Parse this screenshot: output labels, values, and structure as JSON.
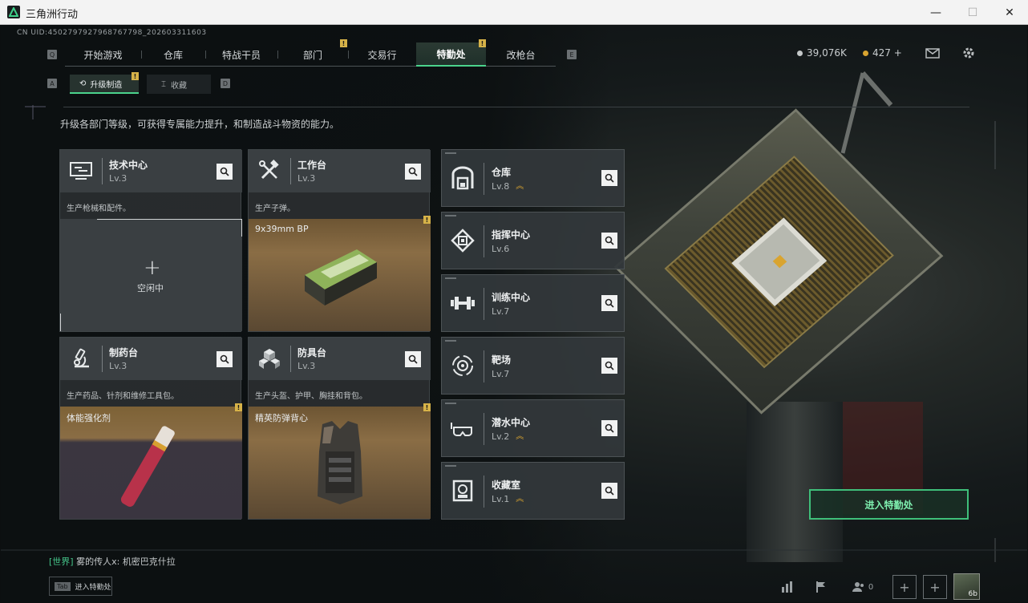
{
  "window": {
    "title": "三角洲行动",
    "minimize": "—",
    "maximize": "☐",
    "close": "✕"
  },
  "uid": "CN UID:4502797927968767798_202603311603",
  "nav": {
    "key_left": "Q",
    "key_right": "E",
    "tabs": [
      {
        "label": "开始游戏"
      },
      {
        "label": "仓库"
      },
      {
        "label": "特战干员"
      },
      {
        "label": "部门"
      },
      {
        "label": "交易行"
      },
      {
        "label": "特勤处"
      },
      {
        "label": "改枪台"
      }
    ],
    "active": "特勤处"
  },
  "subnav": {
    "key_left": "A",
    "key_right": "D",
    "tabs": [
      {
        "label": "升级制造"
      },
      {
        "label": "收藏"
      }
    ]
  },
  "currency": {
    "coins": "39,076K",
    "bonds": "427 +",
    "coin_color": "#c4c8c9",
    "bond_color": "#d9a430"
  },
  "description": "升级各部门等级，可获得专属能力提升，和制造战斗物资的能力。",
  "workshops": [
    {
      "name": "技术中心",
      "level": "Lv.3",
      "desc": "生产枪械和配件。",
      "slot_title": "",
      "idle": "空闲中",
      "icon": "computer-icon"
    },
    {
      "name": "工作台",
      "level": "Lv.3",
      "desc": "生产子弹。",
      "slot_title": "9x39mm BP",
      "icon": "hammer-wrench-icon"
    },
    {
      "name": "制药台",
      "level": "Lv.3",
      "desc": "生产药品、针剂和维修工具包。",
      "slot_title": "体能强化剂",
      "icon": "microscope-icon"
    },
    {
      "name": "防具台",
      "level": "Lv.3",
      "desc": "生产头盔、护甲、胸挂和背包。",
      "slot_title": "精英防弹背心",
      "icon": "armor-cubes-icon"
    }
  ],
  "departments": [
    {
      "name": "仓库",
      "level": "Lv.8",
      "upgrade": true,
      "icon": "warehouse-icon"
    },
    {
      "name": "指挥中心",
      "level": "Lv.6",
      "upgrade": false,
      "icon": "command-chip-icon"
    },
    {
      "name": "训练中心",
      "level": "Lv.7",
      "upgrade": false,
      "icon": "dumbbell-icon"
    },
    {
      "name": "靶场",
      "level": "Lv.7",
      "upgrade": false,
      "icon": "target-icon"
    },
    {
      "name": "潜水中心",
      "level": "Lv.2",
      "upgrade": true,
      "icon": "diving-mask-icon"
    },
    {
      "name": "收藏室",
      "level": "Lv.1",
      "upgrade": true,
      "icon": "collection-icon"
    }
  ],
  "enter_button": "进入特勤处",
  "chat": {
    "channel": "[世界]",
    "sender": "雾的传人x:",
    "message": "机密巴克什拉"
  },
  "tab_hint": {
    "key": "Tab",
    "label": "进入特勤处"
  },
  "social": {
    "friends_count": "0"
  },
  "avatar_label": "6b"
}
